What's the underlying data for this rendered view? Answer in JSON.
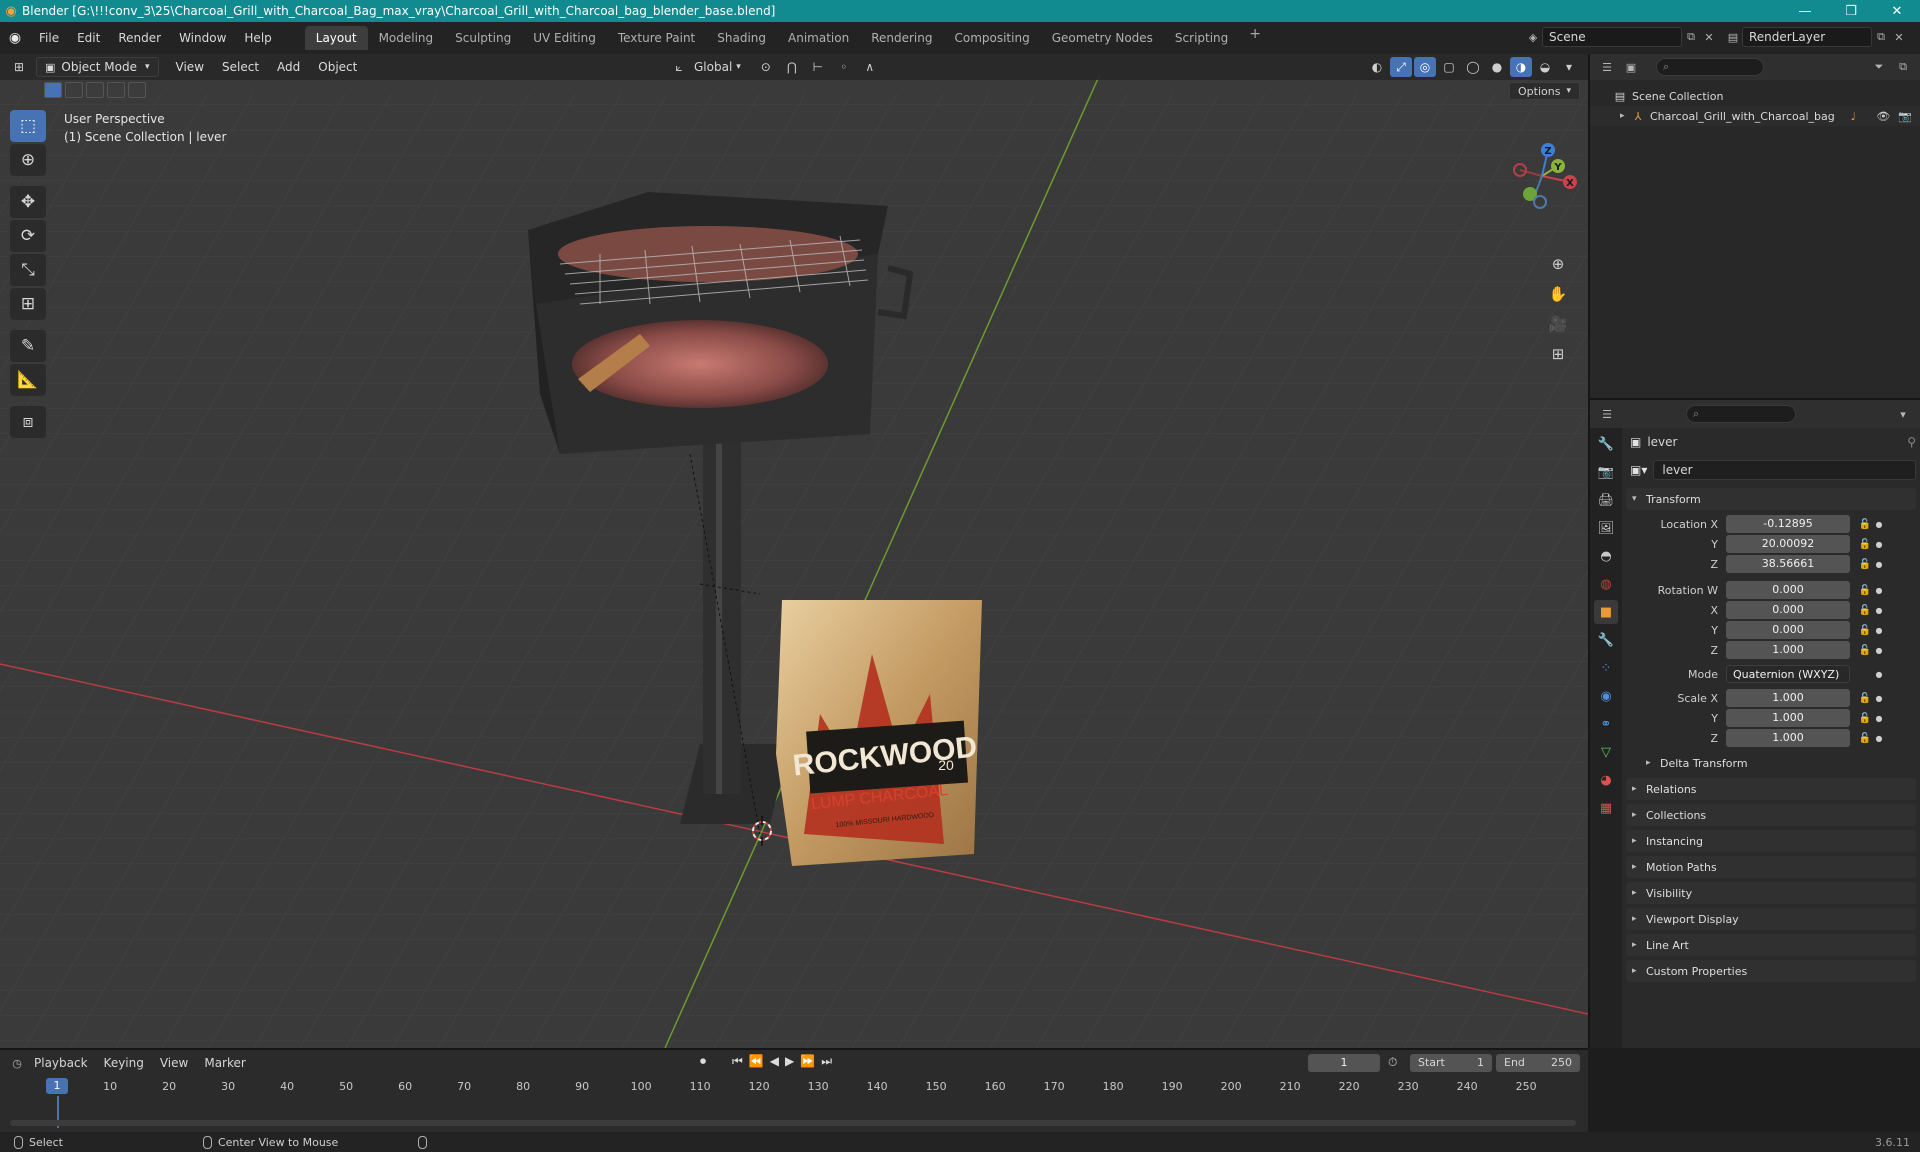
{
  "window": {
    "title": "Blender [G:\\!!!conv_3\\25\\Charcoal_Grill_with_Charcoal_Bag_max_vray\\Charcoal_Grill_with_Charcoal_bag_blender_base.blend]",
    "minimize": "—",
    "maximize": "❐",
    "close": "✕"
  },
  "menu": [
    "File",
    "Edit",
    "Render",
    "Window",
    "Help"
  ],
  "workspaces": [
    "Layout",
    "Modeling",
    "Sculpting",
    "UV Editing",
    "Texture Paint",
    "Shading",
    "Animation",
    "Rendering",
    "Compositing",
    "Geometry Nodes",
    "Scripting"
  ],
  "active_workspace": "Layout",
  "add_tab": "+",
  "scene": {
    "name": "Scene",
    "view_layer": "RenderLayer"
  },
  "viewport": {
    "mode": "Object Mode",
    "menus": [
      "View",
      "Select",
      "Add",
      "Object"
    ],
    "transform_orientation": "Global",
    "options_label": "Options",
    "info_line1": "User Perspective",
    "info_line2": "(1) Scene Collection | lever",
    "gizmo_axes": {
      "x": "X",
      "y": "Y",
      "z": "Z"
    },
    "bag_brand": "ROCKWOOD",
    "bag_subtitle": "LUMP CHARCOAL",
    "bag_tagline": "100% MISSOURI HARDWOOD",
    "bag_weight": "20"
  },
  "outliner": {
    "search_placeholder": "",
    "root": "Scene Collection",
    "items": [
      {
        "name": "Charcoal_Grill_with_Charcoal_bag"
      }
    ]
  },
  "properties": {
    "object_name": "lever",
    "data_name": "lever",
    "transform_header": "Transform",
    "location": {
      "label": "Location X",
      "x": "-0.12895",
      "y": "20.00092",
      "z": "38.56661"
    },
    "rotation": {
      "label": "Rotation W",
      "w": "0.000",
      "x": "0.000",
      "y": "0.000",
      "z": "1.000"
    },
    "mode_label": "Mode",
    "mode_value": "Quaternion (WXYZ)",
    "scale": {
      "label": "Scale X",
      "x": "1.000",
      "y": "1.000",
      "z": "1.000"
    },
    "axis_labels": {
      "y": "Y",
      "z": "Z",
      "x": "X"
    },
    "delta_transform": "Delta Transform",
    "panels": [
      "Relations",
      "Collections",
      "Instancing",
      "Motion Paths",
      "Visibility",
      "Viewport Display",
      "Line Art",
      "Custom Properties"
    ]
  },
  "timeline": {
    "menus": [
      "Playback",
      "Keying",
      "View",
      "Marker"
    ],
    "current_frame": "1",
    "start_label": "Start",
    "start_value": "1",
    "end_label": "End",
    "end_value": "250",
    "ticks": [
      "10",
      "20",
      "30",
      "40",
      "50",
      "60",
      "70",
      "80",
      "90",
      "100",
      "110",
      "120",
      "130",
      "140",
      "150",
      "160",
      "170",
      "180",
      "190",
      "200",
      "210",
      "220",
      "230",
      "240",
      "250"
    ]
  },
  "statusbar": {
    "select": "Select",
    "center_view": "Center View to Mouse",
    "version": "3.6.11"
  }
}
